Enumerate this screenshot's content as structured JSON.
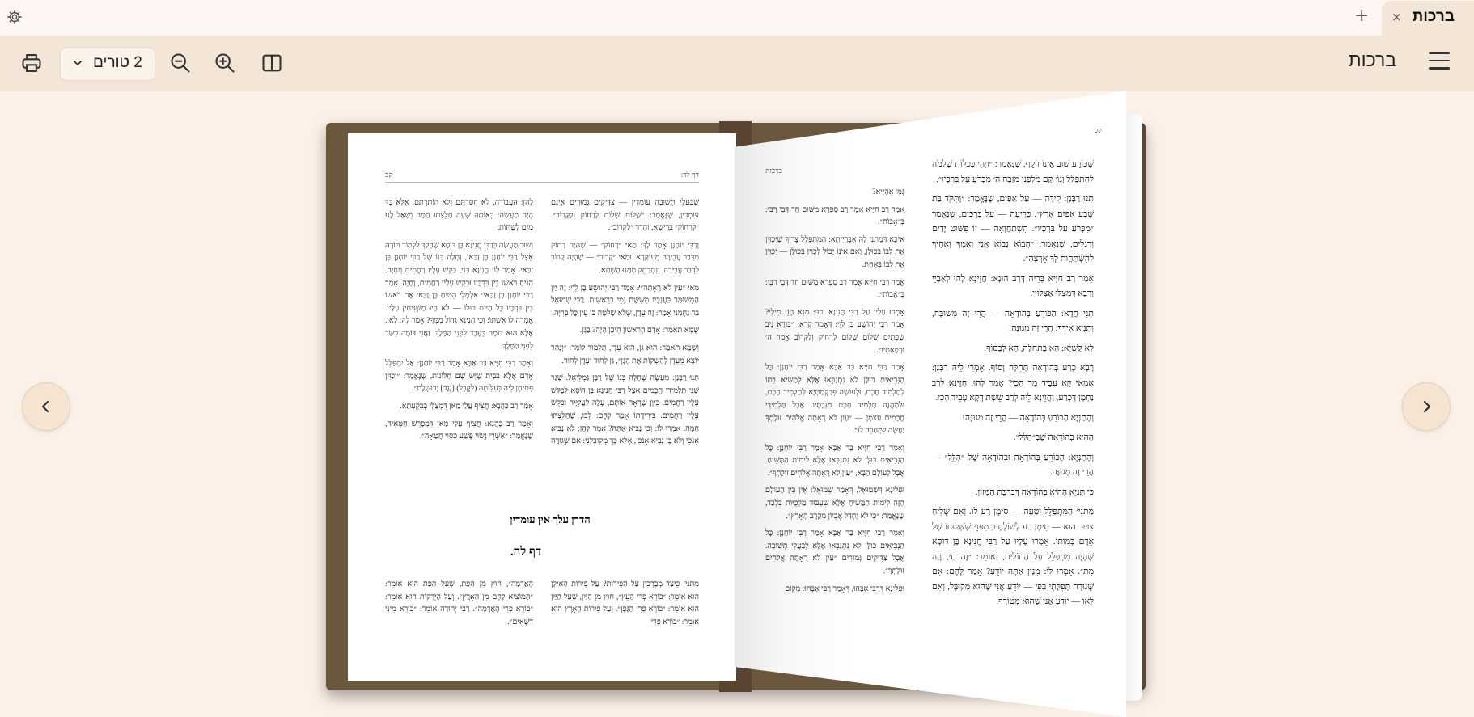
{
  "tab": {
    "title": "ברכות",
    "close": "×",
    "add": "+"
  },
  "toolbar": {
    "columns_label": "2 טורים",
    "book_title": "ברכות"
  },
  "book": {
    "left_page": {
      "header_right": "דף לד:",
      "header_left": "קכ",
      "col_right": [
        "שֶׁבַּעֲלֵי תְשׁוּבָה עוֹמְדִין — צַדִּיקִים גְּמוּרִים אֵינָם עוֹמְדִין, שֶׁנֶּאֱמַר: ״שָׁלוֹם שָׁלוֹם לָרָחוֹק וְלַקָּרוֹב״. ״לָרָחוֹק״ בְּרֵישָׁא, וַהֲדַר ״לַקָּרוֹב״.",
        "וְרַבִּי יוֹחָנָן אָמַר לָךְ: מַאי ״רָחוֹק״ — שֶׁהָיָה רָחוֹק מִדְּבַר עֲבֵירָה מֵעִיקָּרָא. וּמַאי ״קָרוֹב״ — שֶׁהָיָה קָרוֹב לִדְבַר עֲבֵירָה, וְנִתְרַחֵק מִמֶּנּוּ הַשְׁתָּא.",
        "מַאי ״עַיִן לֹא רָאָתָה״? אָמַר רַבִּי יְהוֹשֻׁעַ בֶּן לֵוִי: זֶה יַיִן הַמְשׁוּמָּר בַּעֲנָבָיו מִשֵּׁשֶׁת יְמֵי בְרֵאשִׁית. רַבִּי שְׁמוּאֵל בַּר נַחְמָנִי אָמַר: זֶה עֵדֶן, שֶׁלֹּא שָׁלְטָה בּוֹ עֵין כׇּל בְּרִיָּה.",
        "שֶׁמָּא תֹּאמַר: אָדָם הָרִאשׁוֹן הֵיכָן הָיָה? בַּגָּן.",
        "וְשֶׁמָּא תֹּאמַר: הוּא גַּן, הוּא עֵדֶן, תַּלְמוּד לוֹמַר: ״וְנָהָר יוֹצֵא מֵעֵדֶן לְהַשְׁקוֹת אֶת הַגָּן״, גַּן לְחוּד וְעֵדֶן לְחוּד.",
        "תָּנוּ רַבָּנַן: מַעֲשֶׂה שֶׁחָלָה בְּנוֹ שֶׁל רַבָּן גַּמְלִיאֵל. שָׁגַר שְׁנֵי תַלְמִידֵי חֲכָמִים אֵצֶל רַבִּי חֲנִינָא בֶּן דּוֹסָא לְבַקֵּשׁ עָלָיו רַחֲמִים. כֵּיוָן שֶׁרָאָה אוֹתָם, עָלָה לַעֲלִיָּיה וּבִקֵּשׁ עָלָיו רַחֲמִים. בִּירִידָתוֹ אָמַר לָהֶם: לְכוּ, שֶׁחַלְּצַתּוּ חַמָּה. אָמְרוּ לוֹ: וְכִי נָבִיא אַתָּה? אָמַר לָהֶן: לֹא נָבִיא אָנֹכִי וְלֹא בֶּן נָבִיא אָנֹכִי, אֶלָּא כָּךְ מְקוּבְּלַנִי: אִם שְׁגוּרָה תְּפִלָּתִי בְּפִי — יוֹדֵעַ אֲנִי שֶׁהוּא מְקוּבָּל, וְאִם לָאו — יוֹדֵעַ אֲנִי שֶׁהוּא מְטוֹרָף. יָשְׁבוּ וְכָתְבוּ וְכִוְּונוּ אוֹתָהּ שָׁעָה, וּכְשֶׁבָּאוּ אֵצֶל רַבָּן גַּמְלִיאֵל, אָמַר"
      ],
      "col_left": [
        "לָהֶן: הָעֲבוֹדָה, לֹא חִסַּרְתֶּם וְלֹא הוֹתַרְתֶּם, אֶלָּא כָּךְ הָיָה מַעֲשֶׂה: בְּאוֹתָהּ שָׁעָה חַלְּצַתּוּ חַמָּה וְשָׁאַל לָנוּ מַיִם לִשְׁתּוֹת.",
        "וְשׁוּב מַעֲשֶׂה בְּרַבִּי חֲנִינָא בֶּן דּוֹסָא שֶׁהָלַךְ לִלְמוֹד תּוֹרָה אֵצֶל רַבִּי יוֹחָנָן בֶּן זַכַּאי, וְחָלָה בְּנוֹ שֶׁל רַבִּי יוֹחָנָן בֶּן זַכַּאי. אָמַר לוֹ: חֲנִינָא בְּנִי, בַּקֵּשׁ עָלָיו רַחֲמִים וְיִחְיֶה. הִנִּיחַ רֹאשׁוֹ בֵּין בִּרְכָּיו וּבִקֵּשׁ עָלָיו רַחֲמִים, וְחָיָה. אָמַר רַבִּי יוֹחָנָן בֶּן זַכַּאי: אִלְמָלֵי הֵטִיחַ בֶּן זַכַּאי אֶת רֹאשׁוֹ בֵּין בִּרְכָּיו כׇּל הַיּוֹם כּוּלּוֹ — לֹא הָיוּ מַשְׁגִּיחִין עָלָיו. אָמְרָה לוֹ אִשְׁתּוֹ: וְכִי חֲנִינָא גָּדוֹל מִמְּךָ? אָמַר לָהּ: לָאו, אֶלָּא הוּא דּוֹמֶה כְּעֶבֶד לִפְנֵי הַמֶּלֶךְ, וַאֲנִי דּוֹמֶה כְּשַׂר לִפְנֵי הַמֶּלֶךְ.",
        "וְאָמַר רַבִּי חִיָּיא בַּר אַבָּא אָמַר רַבִּי יוֹחָנָן: אַל יִתְפַּלֵּל אָדָם אֶלָּא בְּבַיִת שֶׁיֵּשׁ שָׁם חַלּוֹנוֹת, שֶׁנֶּאֱמַר: ״וְכַוִּין פְּתִיחָן לֵיהּ בְּעִלִּיתֵהּ (לְקֳבֵל) [נֶגֶד] יְרוּשְׁלֶם״.",
        "אָמַר רַב כָּהֲנָא: חֲצִיף עֲלַי מַאן דִּמְצַלֵּי בְּבִקְעָתָא.",
        "וְאָמַר רַב כָּהֲנָא: חֲצִיף עֲלַי מַאן דִּמְפָרֵשׁ חֶטְאֵיהּ, שֶׁנֶּאֱמַר: ״אַשְׁרֵי נְשׂוּי פֶּשַׁע כְּסוּי חֲטָאָה״."
      ],
      "hadran": "הדרן עלך אין עומדין",
      "daf_title": "דף לה.",
      "mishna_right": "מתני׳ כֵּיצַד מְבָרְכִין עַל הַפֵּירוֹת? עַל פֵּירוֹת הָאִילָן הוּא אוֹמֵר: ״בּוֹרֵא פְּרִי הָעֵץ״, חוּץ מִן הַיַּיִן, שֶׁעַל הַיַּיִן הוּא אוֹמֵר: ״בּוֹרֵא פְּרִי הַגָּפֶן״. וְעַל פֵּירוֹת הָאָרֶץ הוּא אוֹמֵר: ״בּוֹרֵא פְּרִי",
      "mishna_left": "הָאֲדָמָה״, חוּץ מִן הַפַּת, שֶׁעַל הַפַּת הוּא אוֹמֵר: ״הַמּוֹצִיא לֶחֶם מִן הָאָרֶץ״. וְעַל הַיְּרָקוֹת הוּא אוֹמֵר: ״בּוֹרֵא פְּרִי הָאֲדָמָה״. רַבִּי יְהוּדָה אוֹמֵר: ״בּוֹרֵא מִינֵי דְשָׁאִים״."
    },
    "right_page": {
      "header_corner": "קכ",
      "header_right_col": "ברכות",
      "col_right": [
        "שֶׁכּוֹרֵעַ שׁוּב אֵינוֹ זוֹקֵף, שֶׁנֶּאֱמַר: ״וַיְהִי כְּכַלּוֹת שְׁלֹמֹה לְהִתְפַּלֵּל וְגוֹ׳ קָם מִלִּפְנֵי מִזְבַּח ה׳ מִכְּרֹעַ עַל בִּרְכָּיו״.",
        "תָּנוּ רַבָּנַן: קִידָּה — עַל אַפַּיִם, שֶׁנֶּאֱמַר: ״וַתִּקֹּד בַּת שֶׁבַע אַפַּיִם אֶרֶץ״. כְּרִיעָה — עַל בִּרְכַּיִם, שֶׁנֶּאֱמַר ״מִכְּרֹעַ עַל בִּרְכָּיו״. הִשְׁתַּחֲוָאָה — זוֹ פִּשּׁוּט יָדַיִם וְרַגְלַיִם, שֶׁנֶּאֱמַר: ״הֲבוֹא נָבוֹא אֲנִי וְאִמְּךָ וְאַחֶיךָ לְהִשְׁתַּחֲוֹת לְךָ אָרְצָה״.",
        "אָמַר רַב חִיָּיא בְּרֵיהּ דְּרַב הוּנָא: חֲזֵינָא לְהוּ לְאַבָּיֵי וְרָבָא דְּמַצְלוּ אַצְלוּיֵי.",
        "תָּנֵי חֲדָא: הַכּוֹרֵעַ בְּהוֹדָאָה — הֲרֵי זֶה מְשׁוּבָּח, וְתַנְיָא אִידַּךְ: הֲרֵי זֶה מְגוּנֶּה!",
        "לָא קַשְׁיָא: הָא בַּתְּחִלָּה, הָא לְבַסּוֹף.",
        "רָבָא כָּרַע בְּהוֹדָאָה תְּחִלָּה וָסוֹף. אָמְרִי לֵיהּ רַבָּנַן: אַמַּאי קָא עָבֵיד מָר הָכִי? אָמַר לְהוּ: חֲזֵינָא לְרַב נַחְמָן דְּכָרַע, וַחֲזֵינָא לֵיהּ לְרַב שֵׁשֶׁת דְּקָא עָבֵיד הָכִי.",
        "וְהָתַנְיָא הַכּוֹרֵעַ בְּהוֹדָאָה — הֲרֵי זֶה מְגוּנֶּה!",
        "הַהִיא בְּהוֹדָאָה שֶׁבְּ״הַלֵּל״.",
        "וְהָתַנְיָא: הַכּוֹרֵעַ בְּהוֹדָאָה וּבְהוֹדָאָה שֶׁל ״הַלֵּל״ — הֲרֵי זֶה מְגוּנֶּה.",
        "כִּי תַּנְיָא הַהִיא בְּהוֹדָאָה דְּבִרְכַּת הַמָּזוֹן.",
        "מַתְנִי׳ הַמִּתְפַּלֵּל וְטָעָה — סִימָן רַע לוֹ. וְאִם שְׁלִיחַ צִבּוּר הוּא — סִימָן רַע לְשׁוֹלְחָיו, מִפְּנֵי שֶׁשְּׁלוּחוֹ שֶׁל אָדָם כְּמוֹתוֹ. אָמְרוּ עָלָיו עַל רַבִּי חֲנִינָא בֶּן דּוֹסָא שֶׁהָיָה מִתְפַּלֵּל עַל הַחוֹלִים, וְאוֹמֵר: ״זֶה חַי, וָזֶה מֵת״. אָמְרוּ לוֹ: מִנַּיִן אַתָּה יוֹדֵעַ? אָמַר לָהֶם: אִם שְׁגוּרָה תְּפִלָּתִי בְּפִי — יוֹדֵעַ אֲנִי שֶׁהוּא מְקוּבָּל, וְאִם לָאו — יוֹדֵעַ אֲנִי שֶׁהוּא מְטוֹרָף."
      ],
      "col_left": [
        "גְּמָ׳ אֵהַיָּיא?",
        "אָמַר רַב חִיָּיא אָמַר רַב סָפְרָא מִשּׁוּם חַד דְּבֵי רַבִּי: בַּ״אָבוֹת״.",
        "אִיכָּא דְּמַתְנֵי לַהּ אַבָּרַיְיתָא: הַמִּתְפַּלֵּל צָרִיךְ שֶׁיְּכַוֵּין אֶת לִבּוֹ בְּכוּלָּן, וְאִם אֵינוֹ יָכוֹל לְכַוֵּין בְּכוּלָּן — יְכַוֵּין אֶת לִבּוֹ בְּאַחַת.",
        "אָמַר רַבִּי חִיָּיא אָמַר רַב סָפְרָא מִשּׁוּם חַד דְּבֵי רַבִּי: בְּ״אָבוֹת״.",
        "אָמְרוּ עָלָיו עַל רַבִּי חֲנִינָא וְכוּ׳: מְנָא הָנֵי מִילֵּי? אָמַר רַבִּי יְהוֹשֻׁעַ בֶּן לֵוִי: דְּאָמַר קְרָא: ״בּוֹרֵא נִיב שְׂפָתָיִם שָׁלוֹם שָׁלוֹם לָרָחוֹק וְלַקָּרוֹב אָמַר ה׳ וּרְפָאתִיו״.",
        "אָמַר רַבִּי חִיָּיא בַּר אַבָּא אָמַר רַבִּי יוֹחָנָן: כׇּל הַנְּבִיאִים כּוּלָּן לֹא נִתְנַבְּאוּ אֶלָּא לְמַשִּׂיא בִתּוֹ לְתַלְמִיד חָכָם, וּלְעוֹשֶׂה פְּרַקְמַטְיָא לְתַלְמִיד חָכָם, וּלְמַהֲנֶה תַּלְמִיד חָכָם מִנְּכָסָיו. אֲבָל תַּלְמִידֵי חֲכָמִים עַצְמָן — ״עַיִן לֹא רָאָתָה אֱלֹהִים זוּלָתְךָ יַעֲשֶׂה לִמְחַכֵּה לוֹ״.",
        "וְאָמַר רַבִּי חִיָּיא בַּר אַבָּא אָמַר רַבִּי יוֹחָנָן: כׇּל הַנְּבִיאִים כּוּלָּן לֹא נִתְנַבְּאוּ אֶלָּא לִימוֹת הַמָּשִׁיחַ. אֲבָל לָעוֹלָם הַבָּא, ״עַיִן לֹא רָאָתָה אֱלֹהִים זוּלָתְךָ״.",
        "וּפְלִיגָא דִּשְׁמוּאֵל, דְּאָמַר שְׁמוּאֵל: אֵין בֵּין הָעוֹלָם הַזֶּה לִימוֹת הַמָּשִׁיחַ אֶלָּא שִׁעְבּוּד מַלְכֻיּוֹת בִּלְבַד, שֶׁנֶּאֱמַר: ״כִּי לֹא יֶחְדַּל אֶבְיוֹן מִקֶּרֶב הָאָרֶץ״.",
        "וְאָמַר רַבִּי חִיָּיא בַּר אַבָּא אָמַר רַבִּי יוֹחָנָן: כׇּל הַנְּבִיאִים כּוּלָּן לֹא נִתְנַבְּאוּ אֶלָּא לְבַעֲלֵי תְשׁוּבָה. אֲבָל צַדִּיקִים גְּמוּרִים ״עַיִן לֹא רָאָתָה אֱלֹהִים זוּלָתְךָ״.",
        "וּפְלִיגָא דְּרַבִּי אַבָּהוּ, דְּאָמַר רַבִּי אַבָּהוּ: מָקוֹם"
      ]
    }
  },
  "colors": {
    "tabbar": "#fdf6f3",
    "toolbar": "#f3e6d6",
    "background": "#fbf1e8",
    "cover": "#6b563e"
  },
  "icons": [
    "settings-icon",
    "print-icon",
    "chevron-down-icon",
    "zoom-out-icon",
    "zoom-in-icon",
    "split-view-icon",
    "menu-icon",
    "chevron-left-icon",
    "chevron-right-icon"
  ]
}
